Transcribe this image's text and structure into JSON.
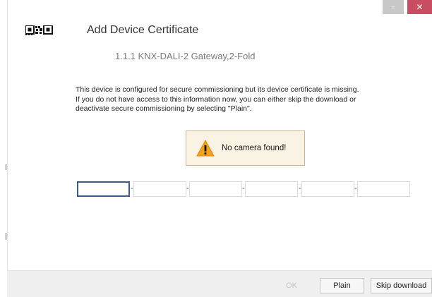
{
  "window": {
    "minimize_glyph": "▫",
    "close_glyph": "✕",
    "close_color": "#c94d62"
  },
  "header": {
    "icon": "qr-code-icon",
    "title": "Add Device Certificate",
    "device": "1.1.1 KNX-DALI-2 Gateway,2-Fold"
  },
  "message": {
    "lines": [
      "This device is configured for secure commissioning but its device certificate is missing.",
      "If you do not have access to this information now, you can either skip the download or",
      "deactivate secure commissioning by selecting \"Plain\"."
    ]
  },
  "camera_notice": {
    "icon": "warning-icon",
    "text": "No camera found!"
  },
  "certificate_fields": {
    "values": [
      "",
      "",
      "",
      "",
      "",
      ""
    ],
    "separator": "-"
  },
  "footer": {
    "ok_label": "OK",
    "plain_label": "Plain",
    "skip_label": "Skip download"
  }
}
